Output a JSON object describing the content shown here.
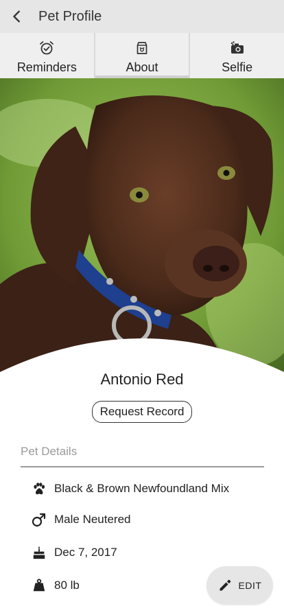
{
  "appbar": {
    "title": "Pet Profile"
  },
  "tabs": [
    {
      "label": "Reminders",
      "icon": "alarm-clock-icon"
    },
    {
      "label": "About",
      "icon": "pet-food-bag-icon"
    },
    {
      "label": "Selfie",
      "icon": "camera-pet-icon"
    }
  ],
  "active_tab": "About",
  "pet": {
    "name": "Antonio Red",
    "request_label": "Request Record"
  },
  "details": {
    "title": "Pet Details",
    "breed": "Black & Brown Newfoundland Mix",
    "sex": "Male Neutered",
    "birthday": "Dec 7, 2017",
    "weight": "80 lb"
  },
  "fab": {
    "label": "EDIT"
  }
}
